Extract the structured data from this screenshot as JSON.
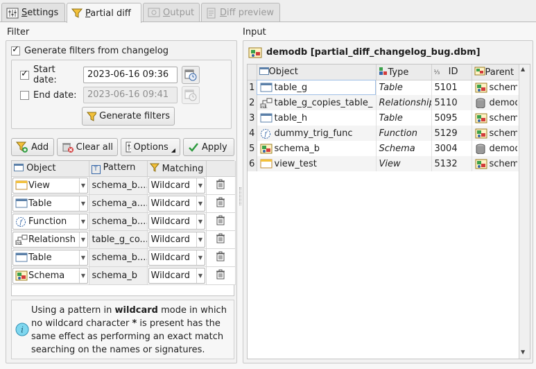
{
  "tabs": [
    {
      "label": "Settings",
      "underline": "S",
      "rest": "ettings",
      "active": false,
      "disabled": false
    },
    {
      "label": "Partial diff",
      "underline": "P",
      "rest": "artial diff",
      "active": true,
      "disabled": false
    },
    {
      "label": "Output",
      "underline": "O",
      "rest": "utput",
      "active": false,
      "disabled": true
    },
    {
      "label": "Diff preview",
      "underline": "D",
      "rest": "iff preview",
      "active": false,
      "disabled": true
    }
  ],
  "filter": {
    "group_label": "Filter",
    "generate_from_changelog": "Generate filters from changelog",
    "start_date_label": "Start date:",
    "start_date_value": "2023-06-16 09:36",
    "end_date_label": "End date:",
    "end_date_value": "2023-06-16 09:41",
    "generate_button": "Generate filters",
    "toolbar": {
      "add": "Add",
      "clear_all": "Clear all",
      "options": "Options",
      "apply": "Apply"
    },
    "columns": {
      "object": "Object",
      "pattern": "Pattern",
      "matching": "Matching"
    },
    "rows": [
      {
        "object": "View",
        "icon": "view-icon",
        "pattern": "schema_b....",
        "matching": "Wildcard"
      },
      {
        "object": "Table",
        "icon": "table-icon",
        "pattern": "schema_a....",
        "matching": "Wildcard"
      },
      {
        "object": "Function",
        "icon": "function-icon",
        "pattern": "schema_b....",
        "matching": "Wildcard"
      },
      {
        "object": "Relationsh",
        "icon": "relationship-icon",
        "pattern": "table_g_co...",
        "matching": "Wildcard"
      },
      {
        "object": "Table",
        "icon": "table-icon",
        "pattern": "schema_b....",
        "matching": "Wildcard"
      },
      {
        "object": "Schema",
        "icon": "schema-icon",
        "pattern": "schema_b",
        "matching": "Wildcard"
      }
    ],
    "info_pre": "Using a pattern in ",
    "info_bold": "wildcard",
    "info_mid": " mode in which no wildcard character ",
    "info_star": "*",
    "info_post": " is present has the same effect as performing an exact match searching on the names or signatures."
  },
  "input": {
    "group_label": "Input",
    "db_title": "demodb [partial_diff_changelog_bug.dbm]",
    "columns": {
      "object": "Object",
      "type": "Type",
      "id": "ID",
      "parent": "Parent"
    },
    "rows": [
      {
        "n": "1",
        "object": "table_g",
        "icon": "table-icon",
        "type": "Table",
        "id": "5101",
        "parent": "schema_",
        "picon": "schema-icon"
      },
      {
        "n": "2",
        "object": "table_g_copies_table_a",
        "icon": "relationship-icon",
        "type": "Relationship",
        "id": "5110",
        "parent": "demodb",
        "picon": "database-icon"
      },
      {
        "n": "3",
        "object": "table_h",
        "icon": "table-icon",
        "type": "Table",
        "id": "5095",
        "parent": "schema_",
        "picon": "schema-icon"
      },
      {
        "n": "4",
        "object": "dummy_trig_func",
        "icon": "function-icon",
        "type": "Function",
        "id": "5129",
        "parent": "schema_",
        "picon": "schema-icon"
      },
      {
        "n": "5",
        "object": "schema_b",
        "icon": "schema-icon",
        "type": "Schema",
        "id": "3004",
        "parent": "demodb",
        "picon": "database-icon"
      },
      {
        "n": "6",
        "object": "view_test",
        "icon": "view-icon",
        "type": "View",
        "id": "5132",
        "parent": "schema_",
        "picon": "schema-icon"
      }
    ]
  }
}
